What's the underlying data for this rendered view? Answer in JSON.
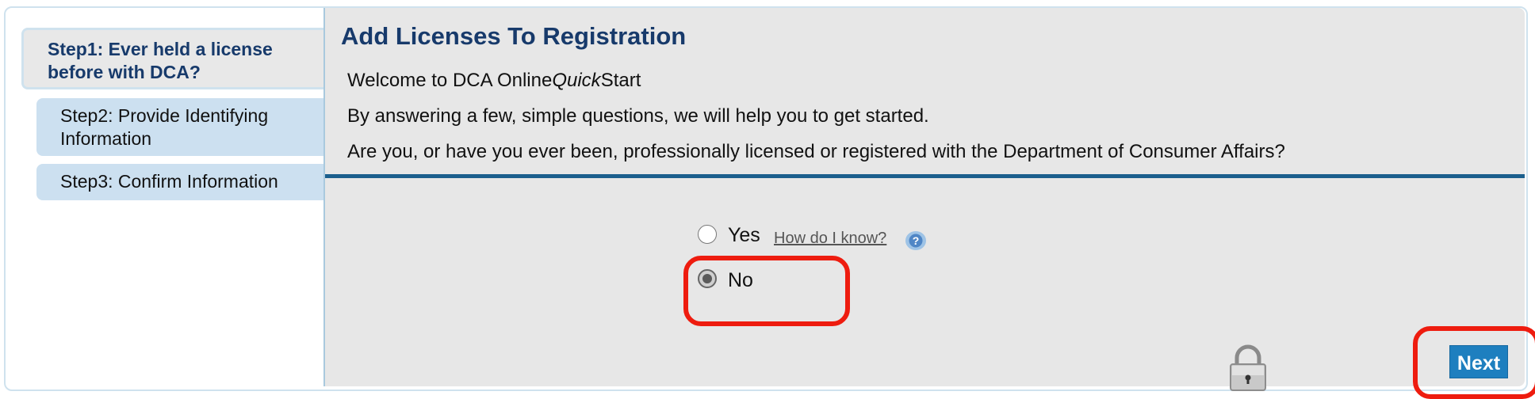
{
  "steps": [
    {
      "label": "Step1: Ever held a license before with DCA?",
      "active": true
    },
    {
      "label": "Step2: Provide Identifying Information",
      "active": false
    },
    {
      "label": "Step3: Confirm Information",
      "active": false
    }
  ],
  "main": {
    "title": "Add Licenses To Registration",
    "welcome_prefix": "Welcome to DCA Online",
    "welcome_italic": "Quick",
    "welcome_suffix": "Start",
    "intro": "By answering a few, simple questions, we will help you to get started.",
    "question": "Are you, or have you ever been, professionally licensed or registered with the Department of Consumer Affairs?"
  },
  "options": {
    "yes_label": "Yes",
    "no_label": "No",
    "selected": "No",
    "help_link": "How do I know?"
  },
  "buttons": {
    "next_label": "Next"
  },
  "colors": {
    "title": "#173a6b",
    "divider": "#1b5f8d",
    "next_button": "#1e7fbf",
    "highlight": "#ee1c0f",
    "step_bg": "#cce0f0"
  },
  "icons": [
    "help-icon",
    "lock-icon"
  ]
}
